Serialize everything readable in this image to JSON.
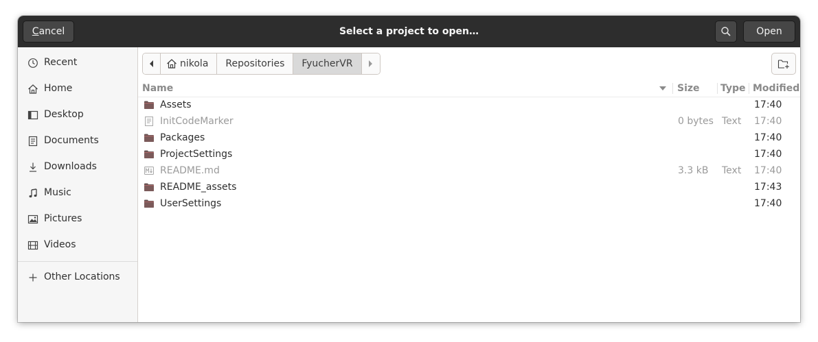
{
  "header": {
    "cancel_prefix": "C",
    "cancel_rest": "ancel",
    "title": "Select a project to open…",
    "open_label": "Open"
  },
  "sidebar": {
    "items": [
      {
        "label": "Recent",
        "icon": "clock-icon"
      },
      {
        "label": "Home",
        "icon": "home-icon"
      },
      {
        "label": "Desktop",
        "icon": "desktop-icon"
      },
      {
        "label": "Documents",
        "icon": "document-icon"
      },
      {
        "label": "Downloads",
        "icon": "download-icon"
      },
      {
        "label": "Music",
        "icon": "music-note-icon"
      },
      {
        "label": "Pictures",
        "icon": "picture-icon"
      },
      {
        "label": "Videos",
        "icon": "film-icon"
      }
    ],
    "other_locations": "Other Locations"
  },
  "pathbar": {
    "segments": [
      "nikola",
      "Repositories",
      "FyucherVR"
    ],
    "active_index": 2
  },
  "columns": {
    "name": "Name",
    "size": "Size",
    "type": "Type",
    "modified": "Modified"
  },
  "files": [
    {
      "name": "Assets",
      "kind": "folder",
      "size": "",
      "type": "",
      "modified": "17:40"
    },
    {
      "name": "InitCodeMarker",
      "kind": "text-file",
      "size": "0 bytes",
      "type": "Text",
      "modified": "17:40"
    },
    {
      "name": "Packages",
      "kind": "folder",
      "size": "",
      "type": "",
      "modified": "17:40"
    },
    {
      "name": "ProjectSettings",
      "kind": "folder",
      "size": "",
      "type": "",
      "modified": "17:40"
    },
    {
      "name": "README.md",
      "kind": "markdown-file",
      "size": "3.3 kB",
      "type": "Text",
      "modified": "17:40"
    },
    {
      "name": "README_assets",
      "kind": "folder",
      "size": "",
      "type": "",
      "modified": "17:43"
    },
    {
      "name": "UserSettings",
      "kind": "folder",
      "size": "",
      "type": "",
      "modified": "17:40"
    }
  ],
  "colors": {
    "headerbar_bg": "#2d2d2d",
    "folder_color": "#7a4a4a",
    "sidebar_bg": "#f6f6f6"
  }
}
